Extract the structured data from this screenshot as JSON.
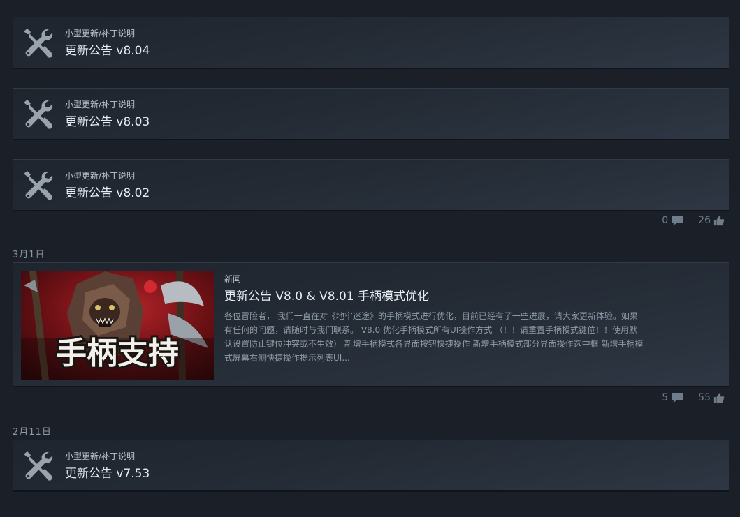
{
  "posts": [
    {
      "category": "小型更新/补丁说明",
      "title": "更新公告 v8.04"
    },
    {
      "category": "小型更新/补丁说明",
      "title": "更新公告 v8.03"
    },
    {
      "category": "小型更新/补丁说明",
      "title": "更新公告 v8.02"
    }
  ],
  "stats_1": {
    "comments": "0",
    "likes": "26"
  },
  "date_1": "3月1日",
  "featured": {
    "category": "新闻",
    "title": "更新公告 V8.0 & V8.01 手柄模式优化",
    "image_text": "手柄支持",
    "description": "各位冒险者， 我们一直在对《地牢迷途》的手柄模式进行优化，目前已经有了一些进展，请大家更新体验。如果有任何的问题，请随时与我们联系。 V8.0 优化手柄模式所有UI操作方式 （！！请重置手柄模式键位！！使用默认设置防止键位冲突或不生效） 新增手柄模式各界面按钮快捷操作 新增手柄模式部分界面操作选中框 新增手柄模式屏幕右侧快捷操作提示列表UI..."
  },
  "stats_2": {
    "comments": "5",
    "likes": "55"
  },
  "date_2": "2月11日",
  "post_last": {
    "category": "小型更新/补丁说明",
    "title": "更新公告 v7.53"
  },
  "icons": {
    "post": "tools-icon",
    "comment": "comment-icon",
    "like": "thumbs-up-icon"
  },
  "colors": {
    "background": "#1b2028",
    "card": "#262d37",
    "accent": "#e6edf3",
    "image_red": "#8c1418"
  }
}
